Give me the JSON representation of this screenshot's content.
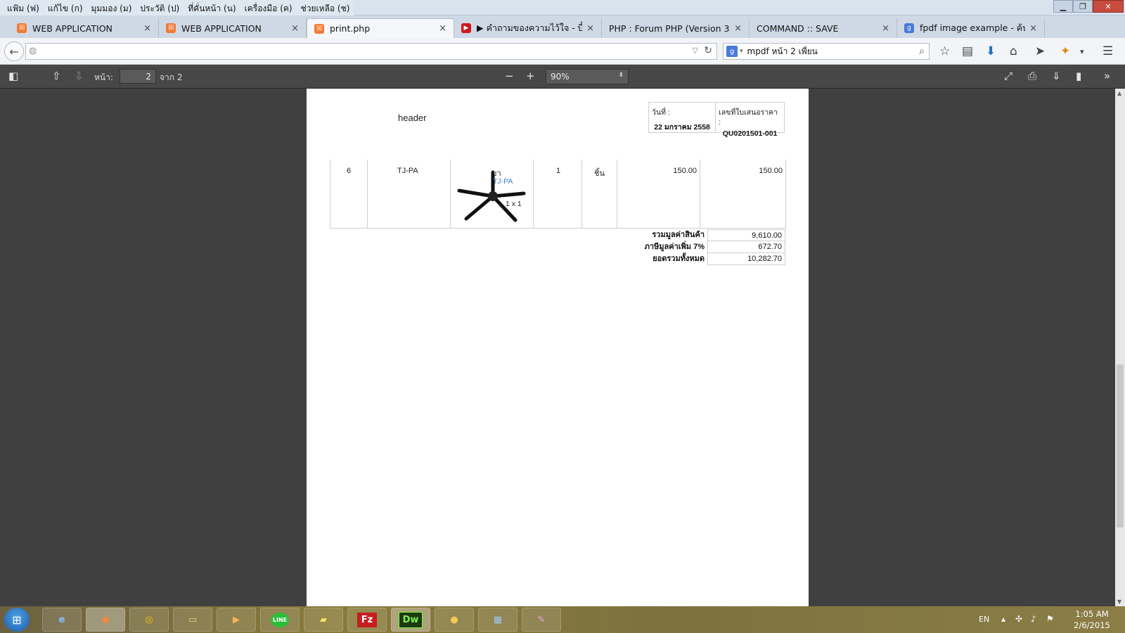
{
  "menu": {
    "items": [
      "แฟ้ม (ฟ)",
      "แก้ไข (ก)",
      "มุมมอง (ม)",
      "ประวัติ (ป)",
      "ที่คั่นหน้า (น)",
      "เครื่องมือ (ค)",
      "ช่วยเหลือ (ช)"
    ]
  },
  "tabs": [
    {
      "title": "WEB APPLICATION",
      "icon": "xampp-icon",
      "color": "#f37a36"
    },
    {
      "title": "WEB APPLICATION",
      "icon": "xampp-icon",
      "color": "#f37a36"
    },
    {
      "title": "print.php",
      "icon": "xampp-icon",
      "color": "#f37a36"
    },
    {
      "title": "▶ คำถามของความไว้ใจ - บี้ ...",
      "icon": "youtube-icon",
      "color": "#cc181e"
    },
    {
      "title": "PHP : Forum PHP (Version 3.0,...",
      "icon": "",
      "color": ""
    },
    {
      "title": "COMMAND :: SAVE",
      "icon": "",
      "color": ""
    },
    {
      "title": "fpdf image example - ค้นห...",
      "icon": "google-icon",
      "color": "#4a7ad8"
    }
  ],
  "nav": {
    "url": "",
    "search_value": "mpdf หน้า 2 เพี้ยน"
  },
  "pdf_toolbar": {
    "page_label": "หน้า:",
    "page_value": "2",
    "page_of": "จาก 2",
    "zoom": "90%"
  },
  "document": {
    "header": "header",
    "date_label": "วันที่ :",
    "date_value": "22 มกราคม 2558",
    "quote_label": "เลขที่ใบเสนอราคา :",
    "quote_value": "QU0201501-001",
    "item": {
      "no": "6",
      "code": "TJ-PA",
      "desc_top": "ขา",
      "desc_name": "TJ-PA",
      "desc_size": "1 x 1",
      "qty": "1",
      "unit": "ชิ้น",
      "price": "150.00",
      "amount": "150.00"
    },
    "totals": [
      {
        "label": "รวมมูลค่าสินค้า",
        "value": "9,610.00"
      },
      {
        "label": "ภาษีมูลค่าเพิ่ม 7%",
        "value": "672.70"
      },
      {
        "label": "ยอดรวมทั้งหมด",
        "value": "10,282.70"
      }
    ]
  },
  "taskbar": {
    "apps": [
      "internet-explorer-icon",
      "firefox-icon",
      "chrome-icon",
      "file-explorer-icon",
      "media-player-icon",
      "line-icon",
      "sticky-notes-icon",
      "filezilla-icon",
      "dreamweaver-icon",
      "paw-app-icon",
      "calculator-icon",
      "paint-icon"
    ],
    "line_label": "LINE",
    "dw_label": "Dw",
    "fz_label": "Fz",
    "lang": "EN",
    "time": "1:05 AM",
    "date": "2/6/2015"
  }
}
